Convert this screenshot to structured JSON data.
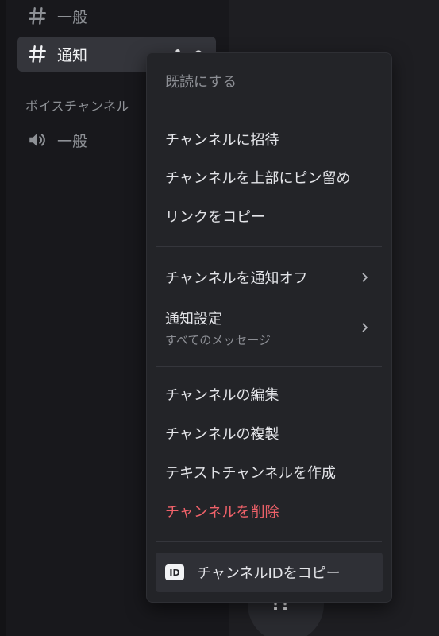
{
  "sidebar": {
    "channels": [
      {
        "label": "一般",
        "type": "text"
      },
      {
        "label": "通知",
        "type": "text",
        "selected": true
      }
    ],
    "voice_category": "ボイスチャンネル",
    "voice_channels": [
      {
        "label": "一般",
        "type": "voice"
      }
    ]
  },
  "context_menu": {
    "mark_read": "既読にする",
    "invite": "チャンネルに招待",
    "pin_top": "チャンネルを上部にピン留め",
    "copy_link": "リンクをコピー",
    "mute": "チャンネルを通知オフ",
    "notification_settings": "通知設定",
    "notification_settings_value": "すべてのメッセージ",
    "edit": "チャンネルの編集",
    "duplicate": "チャンネルの複製",
    "create_text_channel": "テキストチャンネルを作成",
    "delete": "チャンネルを削除",
    "copy_id": "チャンネルIDをコピー",
    "id_badge": "ID"
  },
  "colors": {
    "danger": "#f0626a",
    "menu_bg": "#232428",
    "selected_bg": "#34353b"
  },
  "icons": {
    "text_channel": "hash-icon",
    "voice_channel": "speaker-icon",
    "submenu": "chevron-right-icon"
  },
  "bubble_glyph": "!!"
}
